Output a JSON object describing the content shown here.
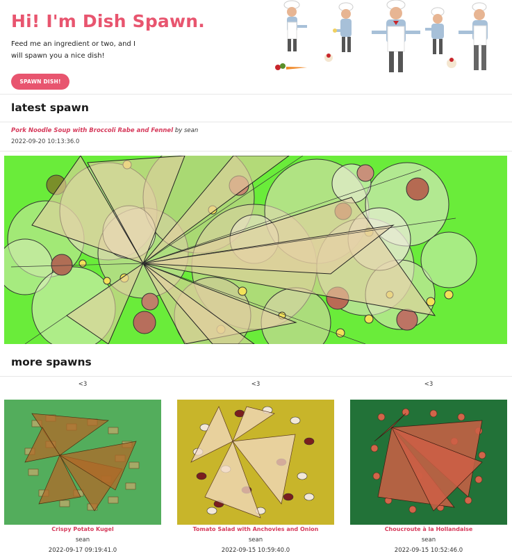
{
  "hero": {
    "title": "Hi! I'm Dish Spawn.",
    "subtitle": "Feed me an ingredient or two, and I will spawn you a nice dish!",
    "button_label": "SPAWN DISH!"
  },
  "latest": {
    "heading": "latest spawn",
    "dish_name": "Pork Noodle Soup with Broccoli Rabe and Fennel",
    "by_text": " by sean",
    "date": "2022-09-20 10:13:36.0",
    "background": "#6aec3a"
  },
  "more": {
    "heading": "more spawns",
    "cards": [
      {
        "heart": "<3",
        "title": "Crispy Potato Kugel",
        "author": "sean",
        "date": "2022-09-17 09:19:41.0",
        "background": "#53ad5c"
      },
      {
        "heart": "<3",
        "title": "Tomato Salad with Anchovies and Onion",
        "author": "sean",
        "date": "2022-09-15 10:59:40.0",
        "background": "#c8b52a"
      },
      {
        "heart": "<3",
        "title": "Choucroute à la Hollandaise",
        "author": "sean",
        "date": "2022-09-15 10:52:46.0",
        "background": "#227238"
      }
    ]
  },
  "colors": {
    "accent": "#e8556f",
    "link": "#d63a5b"
  }
}
